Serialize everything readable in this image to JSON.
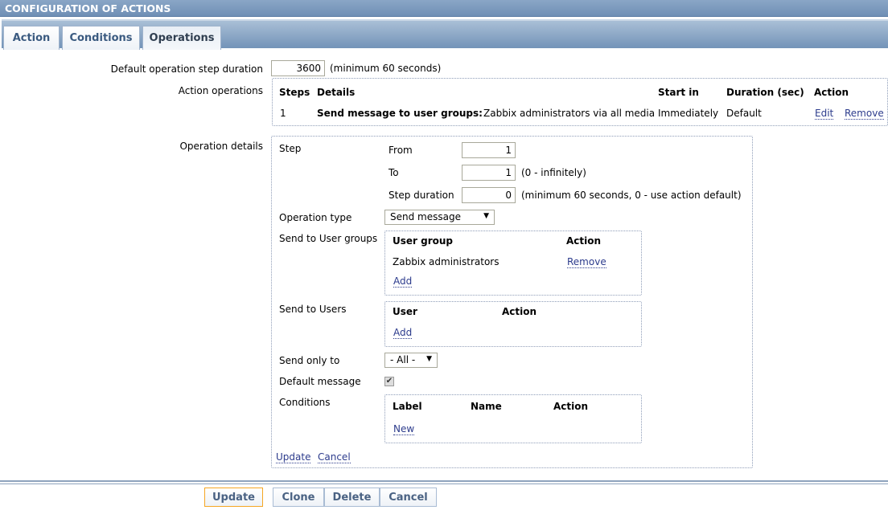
{
  "header": {
    "title": "CONFIGURATION OF ACTIONS"
  },
  "tabs": [
    {
      "label": "Action"
    },
    {
      "label": "Conditions"
    },
    {
      "label": "Operations"
    }
  ],
  "form": {
    "default_step_duration": {
      "label": "Default operation step duration",
      "value": "3600",
      "hint": "(minimum 60 seconds)"
    },
    "action_operations": {
      "label": "Action operations",
      "columns": [
        "Steps",
        "Details",
        "Start in",
        "Duration (sec)",
        "Action"
      ],
      "rows": [
        {
          "steps": "1",
          "details_bold": "Send message to user groups:",
          "details": "Zabbix administrators via all media",
          "start_in": "Immediately",
          "duration": "Default",
          "edit": "Edit",
          "remove": "Remove"
        }
      ]
    },
    "operation_details": {
      "label": "Operation details",
      "step": {
        "label": "Step",
        "from_label": "From",
        "from": "1",
        "to_label": "To",
        "to": "1",
        "to_hint": "(0 - infinitely)",
        "duration_label": "Step duration",
        "duration": "0",
        "duration_hint": "(minimum 60 seconds, 0 - use action default)"
      },
      "operation_type": {
        "label": "Operation type",
        "value": "Send message"
      },
      "user_groups": {
        "label": "Send to User groups",
        "col1": "User group",
        "col2": "Action",
        "rows": [
          {
            "name": "Zabbix administrators",
            "action": "Remove"
          }
        ],
        "add": "Add"
      },
      "users": {
        "label": "Send to Users",
        "col1": "User",
        "col2": "Action",
        "add": "Add"
      },
      "send_only_to": {
        "label": "Send only to",
        "value": "- All -"
      },
      "default_message": {
        "label": "Default message",
        "checked": true
      },
      "conditions": {
        "label": "Conditions",
        "col1": "Label",
        "col2": "Name",
        "col3": "Action",
        "new": "New"
      },
      "update": "Update",
      "cancel": "Cancel"
    }
  },
  "buttons": {
    "update": "Update",
    "clone": "Clone",
    "delete": "Delete",
    "cancel": "Cancel"
  },
  "colors": {
    "header": "#7895b7",
    "update_border": "#f5a623",
    "link": "#2c3b8c"
  }
}
